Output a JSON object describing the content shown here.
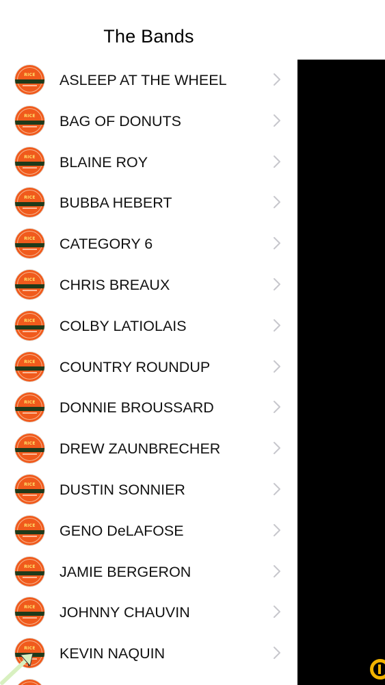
{
  "nav": {
    "title": "The Bands"
  },
  "bands": [
    {
      "name": "ASLEEP AT THE WHEEL"
    },
    {
      "name": "BAG OF DONUTS"
    },
    {
      "name": "BLAINE ROY"
    },
    {
      "name": "BUBBA HEBERT"
    },
    {
      "name": "CATEGORY 6"
    },
    {
      "name": "CHRIS BREAUX"
    },
    {
      "name": "COLBY LATIOLAIS"
    },
    {
      "name": "COUNTRY ROUNDUP"
    },
    {
      "name": "DONNIE BROUSSARD"
    },
    {
      "name": "DREW ZAUNBRECHER"
    },
    {
      "name": "DUSTIN SONNIER"
    },
    {
      "name": "GENO DeLAFOSE"
    },
    {
      "name": "JAMIE BERGERON"
    },
    {
      "name": "JOHNNY CHAUVIN"
    },
    {
      "name": "KEVIN NAQUIN"
    },
    {
      "name": ""
    }
  ],
  "logo": {
    "label": "RICE",
    "icon": "rice-festival-logo-icon"
  },
  "icons": {
    "chevron": "chevron-right-icon",
    "corner": "partial-app-glyph-icon",
    "cursor": "pointer-arrow-icon"
  },
  "colors": {
    "logo_orange": "#f05a1c",
    "logo_stripe": "#1f3a1a",
    "chevron": "#c7c7cc",
    "panel": "#000000",
    "glyph": "#f2b300"
  }
}
